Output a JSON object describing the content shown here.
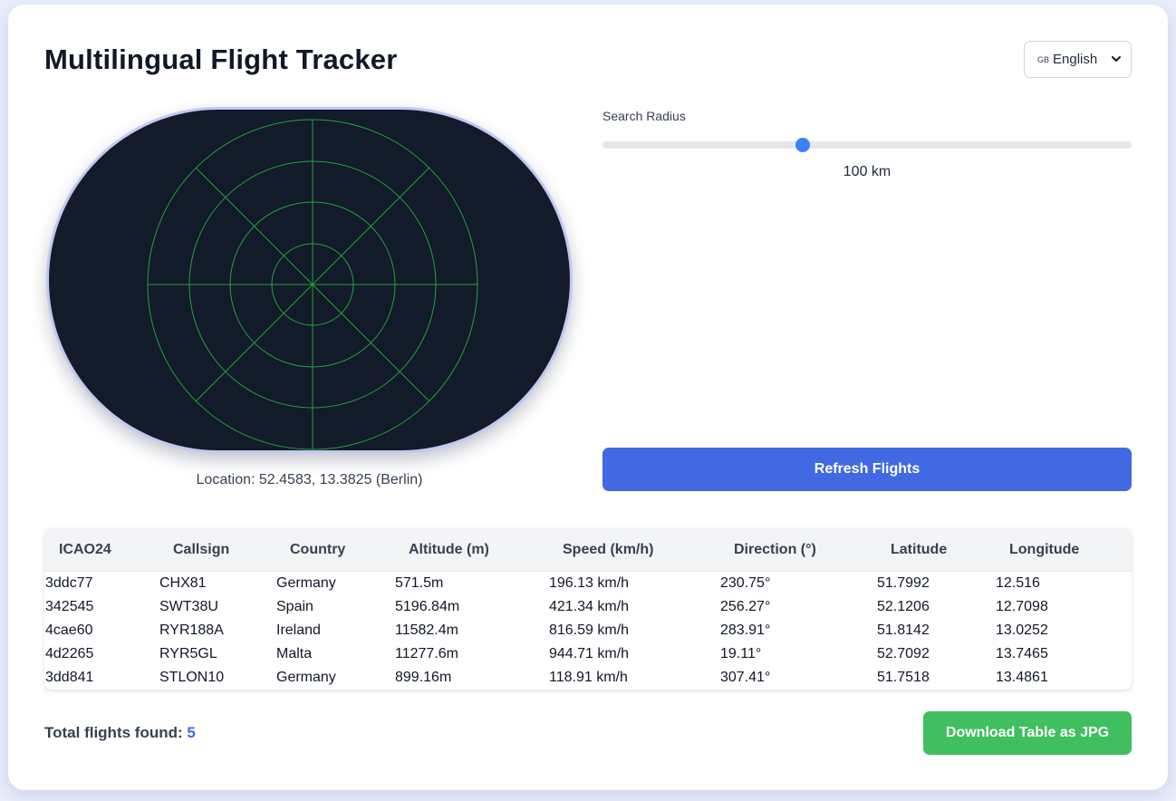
{
  "app": {
    "title": "Multilingual Flight Tracker"
  },
  "language": {
    "flag": "GB",
    "selected": "English"
  },
  "location": {
    "text": "Location: 52.4583, 13.3825 (Berlin)"
  },
  "radius": {
    "label": "Search Radius",
    "value_text": "100 km",
    "slider_fraction": 0.378
  },
  "buttons": {
    "refresh": "Refresh Flights",
    "download": "Download Table as JPG"
  },
  "table": {
    "headers": [
      "ICAO24",
      "Callsign",
      "Country",
      "Altitude (m)",
      "Speed (km/h)",
      "Direction (°)",
      "Latitude",
      "Longitude"
    ],
    "rows": [
      [
        "3ddc77",
        "CHX81",
        "Germany",
        "571.5m",
        "196.13 km/h",
        "230.75°",
        "51.7992",
        "12.516"
      ],
      [
        "342545",
        "SWT38U",
        "Spain",
        "5196.84m",
        "421.34 km/h",
        "256.27°",
        "52.1206",
        "12.7098"
      ],
      [
        "4cae60",
        "RYR188A",
        "Ireland",
        "11582.4m",
        "816.59 km/h",
        "283.91°",
        "51.8142",
        "13.0252"
      ],
      [
        "4d2265",
        "RYR5GL",
        "Malta",
        "11277.6m",
        "944.71 km/h",
        "19.11°",
        "52.7092",
        "13.7465"
      ],
      [
        "3dd841",
        "STLON10",
        "Germany",
        "899.16m",
        "118.91 km/h",
        "307.41°",
        "51.7518",
        "13.4861"
      ]
    ]
  },
  "summary": {
    "label": "Total flights found:",
    "count": "5"
  },
  "colors": {
    "accent": "#4169e1",
    "success": "#3fbf5f",
    "radar_bg": "#131a29",
    "radar_grid": "#22a33a"
  }
}
